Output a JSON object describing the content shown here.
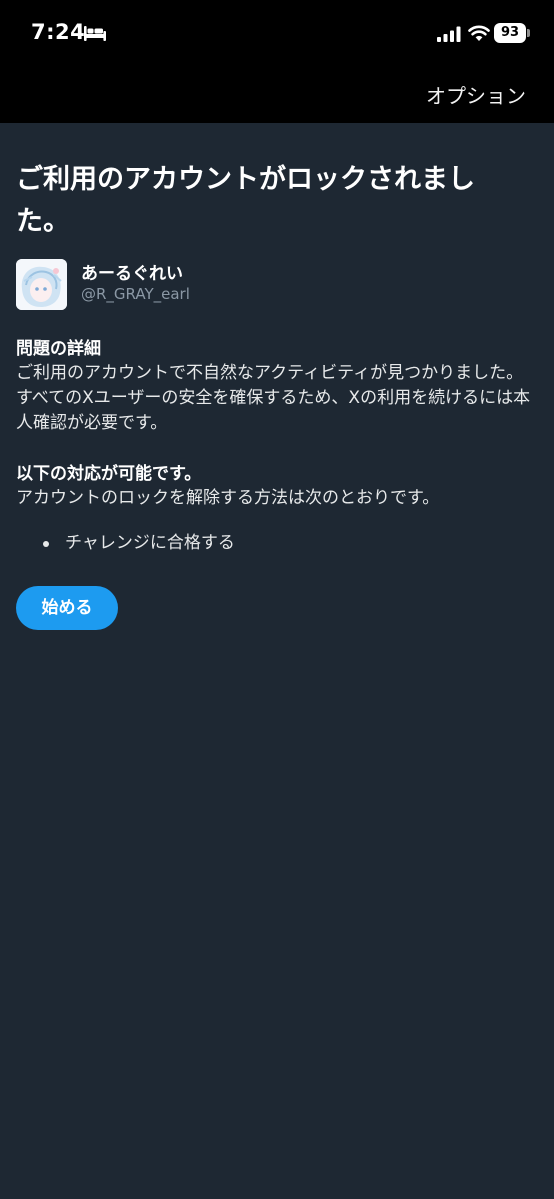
{
  "status_bar": {
    "time": "7:24",
    "battery_level": "93",
    "icons": [
      "bed-icon",
      "signal-icon",
      "wifi-icon",
      "battery-icon"
    ]
  },
  "header": {
    "options_label": "オプション"
  },
  "main": {
    "title": "ご利用のアカウントがロックされました。",
    "account": {
      "display_name": "あーるぐれい",
      "handle": "@R_GRAY_earl"
    },
    "details": {
      "heading": "問題の詳細",
      "body": "ご利用のアカウントで不自然なアクティビティが見つかりました。すべてのXユーザーの安全を確保するため、Xの利用を続けるには本人確認が必要です。"
    },
    "actions": {
      "heading": "以下の対応が可能です。",
      "body": "アカウントのロックを解除する方法は次のとおりです。",
      "items": [
        "チャレンジに合格する"
      ]
    },
    "start_label": "始める"
  },
  "colors": {
    "background": "#1e2833",
    "top_bar": "#000000",
    "accent": "#1d9bf0",
    "secondary_text": "#8b98a5"
  }
}
